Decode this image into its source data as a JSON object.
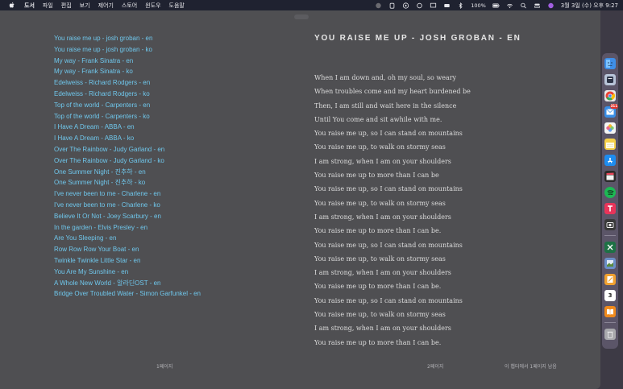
{
  "menubar": {
    "items": [
      "도서",
      "파일",
      "편집",
      "보기",
      "제어기",
      "스토어",
      "윈도우",
      "도움말"
    ],
    "battery": "100%",
    "clock": "3월 3일 (수) 오후 9:27"
  },
  "toc": {
    "items": [
      "You raise me up - josh groban - en",
      "You raise me up - josh groban - ko",
      "My way - Frank Sinatra - en",
      "My way - Frank Sinatra - ko",
      "Edelweiss - Richard Rodgers - en",
      "Edelweiss - Richard Rodgers - ko",
      "Top of the world - Carpenters - en",
      "Top of the world - Carpenters - ko",
      "I Have A Dream - ABBA - en",
      "I Have A Dream - ABBA - ko",
      "Over The Rainbow - Judy Garland - en",
      "Over The Rainbow - Judy Garland - ko",
      "One Summer Night - 진추하 - en",
      "One Summer Night - 진추하 - ko",
      "I've never been to me - Charlene - en",
      "I've never been to me - Charlene - ko",
      "Believe It Or Not - Joey Scarbury - en",
      "In the garden - Elvis Presley - en",
      "Are You Sleeping - en",
      "Row Row Row Your Boat - en",
      "Twinkle Twinkle Little Star - en",
      "You Are My Sunshine - en",
      "A Whole New World - 알라딘OST - en",
      "Bridge Over Troubled Water - Simon Garfunkel - en"
    ]
  },
  "song": {
    "title": "YOU RAISE ME UP - JOSH GROBAN - EN",
    "lines": [
      "When I am down and, oh my soul, so weary",
      "When troubles come and my heart burdened be",
      "Then, I am still and wait here in the silence",
      "Until You come and sit awhile with me.",
      "You raise me up, so I can stand on mountains",
      "You raise me up, to walk on stormy seas",
      "I am strong, when I am on your shoulders",
      "You raise me up to more than I can be",
      "You raise me up, so I can stand on mountains",
      "You raise me up, to walk on stormy seas",
      "I am strong, when I am on your shoulders",
      "You raise me up to more than I can be.",
      "You raise me up, so I can stand on mountains",
      "You raise me up, to walk on stormy seas",
      "I am strong, when I am on your shoulders",
      "You raise me up to more than I can be.",
      "You raise me up, so I can stand on mountains",
      "You raise me up, to walk on stormy seas",
      "I am strong, when I am on your shoulders",
      "You raise me up to more than I can be."
    ]
  },
  "footer": {
    "page_left": "1페이지",
    "page_right": "2페이지",
    "pages_left": "이 챕터에서 1페이지 남음"
  },
  "dock": {
    "mail_badge": "311",
    "calendar_day": "3",
    "colors": {
      "finder": "#3f8fe8",
      "music": "#b8c4d8",
      "chrome": "#e9e9e9",
      "mail": "#3a8ee6",
      "photos": "#f4f4f4",
      "notes": "#f5d04a",
      "appstore": "#1e8cf0",
      "claquette": "#2b2b2b",
      "spotify": "#1db954",
      "t-app": "#e8345a",
      "screenshot": "#3a3a3a",
      "excel": "#1e7145",
      "preview": "#6b8fc7",
      "pages": "#f0a030",
      "calendar": "#ffffff",
      "books": "#f08a1c",
      "trash": "#a9a9ad"
    }
  }
}
